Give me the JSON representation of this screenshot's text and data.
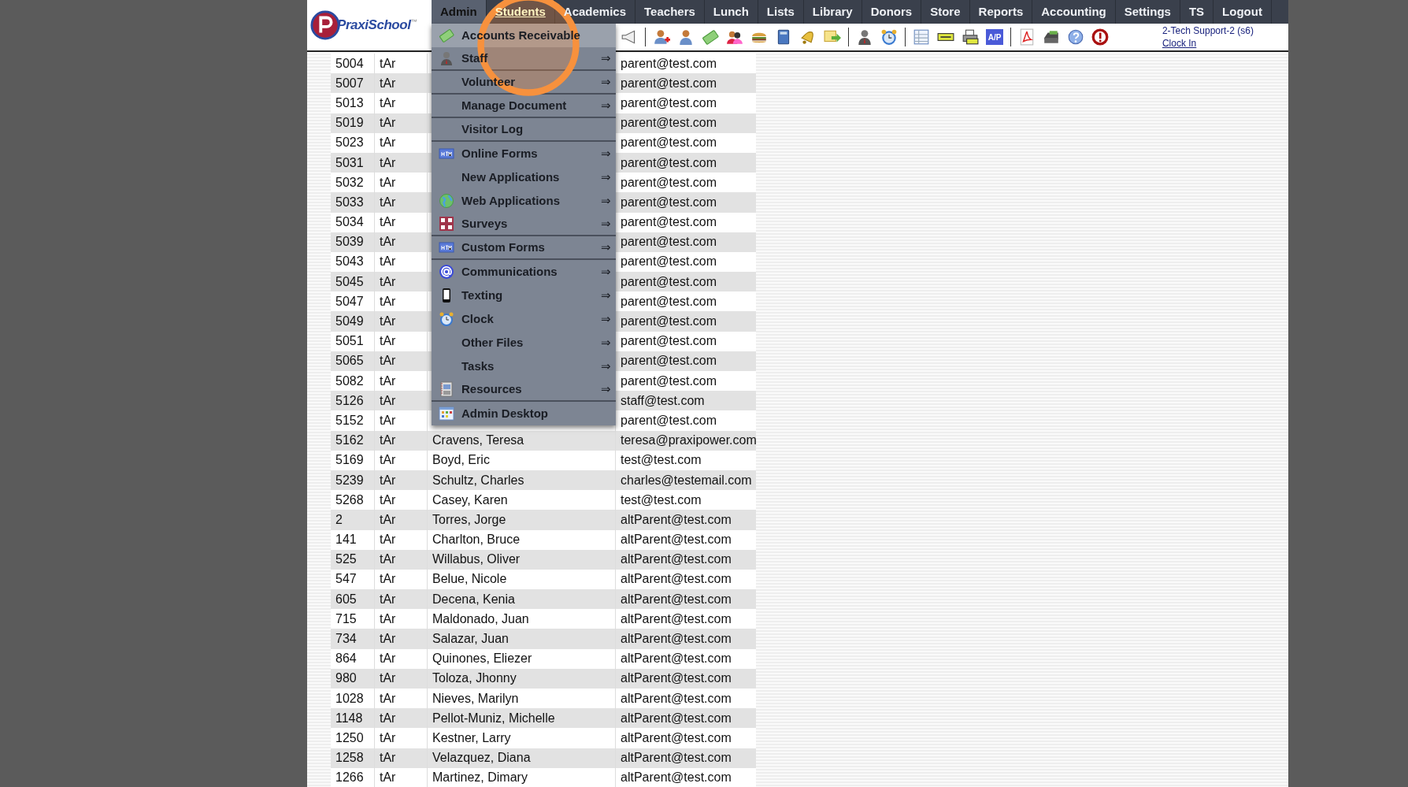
{
  "logo": {
    "text": "PraxiSchool",
    "mark": "™"
  },
  "nav": [
    {
      "label": "Admin",
      "open": true,
      "hovered": false
    },
    {
      "label": "Students",
      "open": false,
      "hovered": true
    },
    {
      "label": "Academics",
      "open": false,
      "hovered": false
    },
    {
      "label": "Teachers",
      "open": false,
      "hovered": false
    },
    {
      "label": "Lunch",
      "open": false,
      "hovered": false
    },
    {
      "label": "Lists",
      "open": false,
      "hovered": false
    },
    {
      "label": "Library",
      "open": false,
      "hovered": false
    },
    {
      "label": "Donors",
      "open": false,
      "hovered": false
    },
    {
      "label": "Store",
      "open": false,
      "hovered": false
    },
    {
      "label": "Reports",
      "open": false,
      "hovered": false
    },
    {
      "label": "Accounting",
      "open": false,
      "hovered": false
    },
    {
      "label": "Settings",
      "open": false,
      "hovered": false
    },
    {
      "label": "TS",
      "open": false,
      "hovered": false
    },
    {
      "label": "Logout",
      "open": false,
      "hovered": false
    }
  ],
  "toolbar": [
    {
      "kind": "megaphone"
    },
    {
      "kind": "separator"
    },
    {
      "kind": "person-add"
    },
    {
      "kind": "person"
    },
    {
      "kind": "money"
    },
    {
      "kind": "people"
    },
    {
      "kind": "burger"
    },
    {
      "kind": "book"
    },
    {
      "kind": "bell"
    },
    {
      "kind": "note-arrow"
    },
    {
      "kind": "separator"
    },
    {
      "kind": "staff"
    },
    {
      "kind": "clock"
    },
    {
      "kind": "separator"
    },
    {
      "kind": "table"
    },
    {
      "kind": "ticket"
    },
    {
      "kind": "printer"
    },
    {
      "kind": "label",
      "text": "A/P"
    },
    {
      "kind": "separator"
    },
    {
      "kind": "pdf"
    },
    {
      "kind": "register"
    },
    {
      "kind": "help"
    },
    {
      "kind": "stop"
    }
  ],
  "user": {
    "name": "2-Tech Support-2 (s6)",
    "link": "Clock In"
  },
  "admin_menu": [
    {
      "label": "Accounts Receivable",
      "kind": "money",
      "hovered": true,
      "divider_after": false
    },
    {
      "label": "Staff",
      "kind": "staff",
      "arrow": "⇒",
      "hovered": false,
      "divider_after": true
    },
    {
      "label": "Volunteer",
      "arrow": "⇒",
      "hovered": false,
      "divider_after": true
    },
    {
      "label": "Manage Document",
      "arrow": "⇒",
      "hovered": false,
      "divider_after": true
    },
    {
      "label": "Visitor Log",
      "hovered": false,
      "divider_after": true
    },
    {
      "label": "Online Forms",
      "kind": "html",
      "arrow": "⇒",
      "hovered": false,
      "divider_after": false
    },
    {
      "label": "New Applications",
      "arrow": "⇒",
      "hovered": false,
      "divider_after": false
    },
    {
      "label": "Web Applications",
      "kind": "globe",
      "arrow": "⇒",
      "hovered": false,
      "divider_after": false
    },
    {
      "label": "Surveys",
      "kind": "survey",
      "arrow": "⇒",
      "hovered": false,
      "divider_after": true
    },
    {
      "label": "Custom Forms",
      "kind": "html",
      "arrow": "⇒",
      "hovered": false,
      "divider_after": true
    },
    {
      "label": "Communications",
      "kind": "at",
      "arrow": "⇒",
      "hovered": false,
      "divider_after": false
    },
    {
      "label": "Texting",
      "kind": "phone",
      "arrow": "⇒",
      "hovered": false,
      "divider_after": false
    },
    {
      "label": "Clock",
      "kind": "clock",
      "arrow": "⇒",
      "hovered": false,
      "divider_after": false
    },
    {
      "label": "Other Files",
      "arrow": "⇒",
      "hovered": false,
      "divider_after": false
    },
    {
      "label": "Tasks",
      "arrow": "⇒",
      "hovered": false,
      "divider_after": false
    },
    {
      "label": "Resources",
      "kind": "resources",
      "arrow": "⇒",
      "hovered": false,
      "divider_after": true
    },
    {
      "label": "Admin Desktop",
      "kind": "desktop",
      "hovered": false,
      "divider_after": false
    }
  ],
  "table": {
    "rows": [
      {
        "column_1": "5004",
        "column_2": "tAr",
        "column_4": "parent@test.com"
      },
      {
        "column_1": "5007",
        "column_2": "tAr",
        "column_4": "parent@test.com"
      },
      {
        "column_1": "5013",
        "column_2": "tAr",
        "column_4": "parent@test.com"
      },
      {
        "column_1": "5019",
        "column_2": "tAr",
        "column_4": "parent@test.com"
      },
      {
        "column_1": "5023",
        "column_2": "tAr",
        "column_4": "parent@test.com"
      },
      {
        "column_1": "5031",
        "column_2": "tAr",
        "column_4": "parent@test.com"
      },
      {
        "column_1": "5032",
        "column_2": "tAr",
        "column_4": "parent@test.com"
      },
      {
        "column_1": "5033",
        "column_2": "tAr",
        "column_4": "parent@test.com"
      },
      {
        "column_1": "5034",
        "column_2": "tAr",
        "column_4": "parent@test.com"
      },
      {
        "column_1": "5039",
        "column_2": "tAr",
        "column_4": "parent@test.com"
      },
      {
        "column_1": "5043",
        "column_2": "tAr",
        "column_4": "parent@test.com"
      },
      {
        "column_1": "5045",
        "column_2": "tAr",
        "column_4": "parent@test.com"
      },
      {
        "column_1": "5047",
        "column_2": "tAr",
        "column_4": "parent@test.com"
      },
      {
        "column_1": "5049",
        "column_2": "tAr",
        "column_4": "parent@test.com"
      },
      {
        "column_1": "5051",
        "column_2": "tAr",
        "column_4": "parent@test.com"
      },
      {
        "column_1": "5065",
        "column_2": "tAr",
        "column_4": "parent@test.com"
      },
      {
        "column_1": "5082",
        "column_2": "tAr",
        "column_4": "parent@test.com"
      },
      {
        "column_1": "5126",
        "column_2": "tAr",
        "column_4": "staff@test.com"
      },
      {
        "column_1": "5152",
        "column_2": "tAr",
        "column_4": "parent@test.com"
      },
      {
        "column_1": "5162",
        "column_2": "tAr",
        "column_3": "Cravens, Teresa",
        "column_4": "teresa@praxipower.com"
      },
      {
        "column_1": "5169",
        "column_2": "tAr",
        "column_3": "Boyd, Eric",
        "column_4": "test@test.com"
      },
      {
        "column_1": "5239",
        "column_2": "tAr",
        "column_3": "Schultz, Charles",
        "column_4": "charles@testemail.com"
      },
      {
        "column_1": "5268",
        "column_2": "tAr",
        "column_3": "Casey, Karen",
        "column_4": "test@test.com"
      },
      {
        "column_1": "2",
        "column_2": "tAr",
        "column_3": "Torres, Jorge",
        "column_4": "altParent@test.com"
      },
      {
        "column_1": "141",
        "column_2": "tAr",
        "column_3": "Charlton, Bruce",
        "column_4": "altParent@test.com"
      },
      {
        "column_1": "525",
        "column_2": "tAr",
        "column_3": "Willabus, Oliver",
        "column_4": "altParent@test.com"
      },
      {
        "column_1": "547",
        "column_2": "tAr",
        "column_3": "Belue, Nicole",
        "column_4": "altParent@test.com"
      },
      {
        "column_1": "605",
        "column_2": "tAr",
        "column_3": "Decena, Kenia",
        "column_4": "altParent@test.com"
      },
      {
        "column_1": "715",
        "column_2": "tAr",
        "column_3": "Maldonado, Juan",
        "column_4": "altParent@test.com"
      },
      {
        "column_1": "734",
        "column_2": "tAr",
        "column_3": "Salazar, Juan",
        "column_4": "altParent@test.com"
      },
      {
        "column_1": "864",
        "column_2": "tAr",
        "column_3": "Quinones, Eliezer",
        "column_4": "altParent@test.com"
      },
      {
        "column_1": "980",
        "column_2": "tAr",
        "column_3": "Toloza, Jhonny",
        "column_4": "altParent@test.com"
      },
      {
        "column_1": "1028",
        "column_2": "tAr",
        "column_3": "Nieves, Marilyn",
        "column_4": "altParent@test.com"
      },
      {
        "column_1": "1148",
        "column_2": "tAr",
        "column_3": "Pellot-Muniz, Michelle",
        "column_4": "altParent@test.com"
      },
      {
        "column_1": "1250",
        "column_2": "tAr",
        "column_3": "Kestner, Larry",
        "column_4": "altParent@test.com"
      },
      {
        "column_1": "1258",
        "column_2": "tAr",
        "column_3": "Velazquez, Diana",
        "column_4": "altParent@test.com"
      },
      {
        "column_1": "1266",
        "column_2": "tAr",
        "column_3": "Martinez, Dimary",
        "column_4": "altParent@test.com"
      }
    ]
  }
}
